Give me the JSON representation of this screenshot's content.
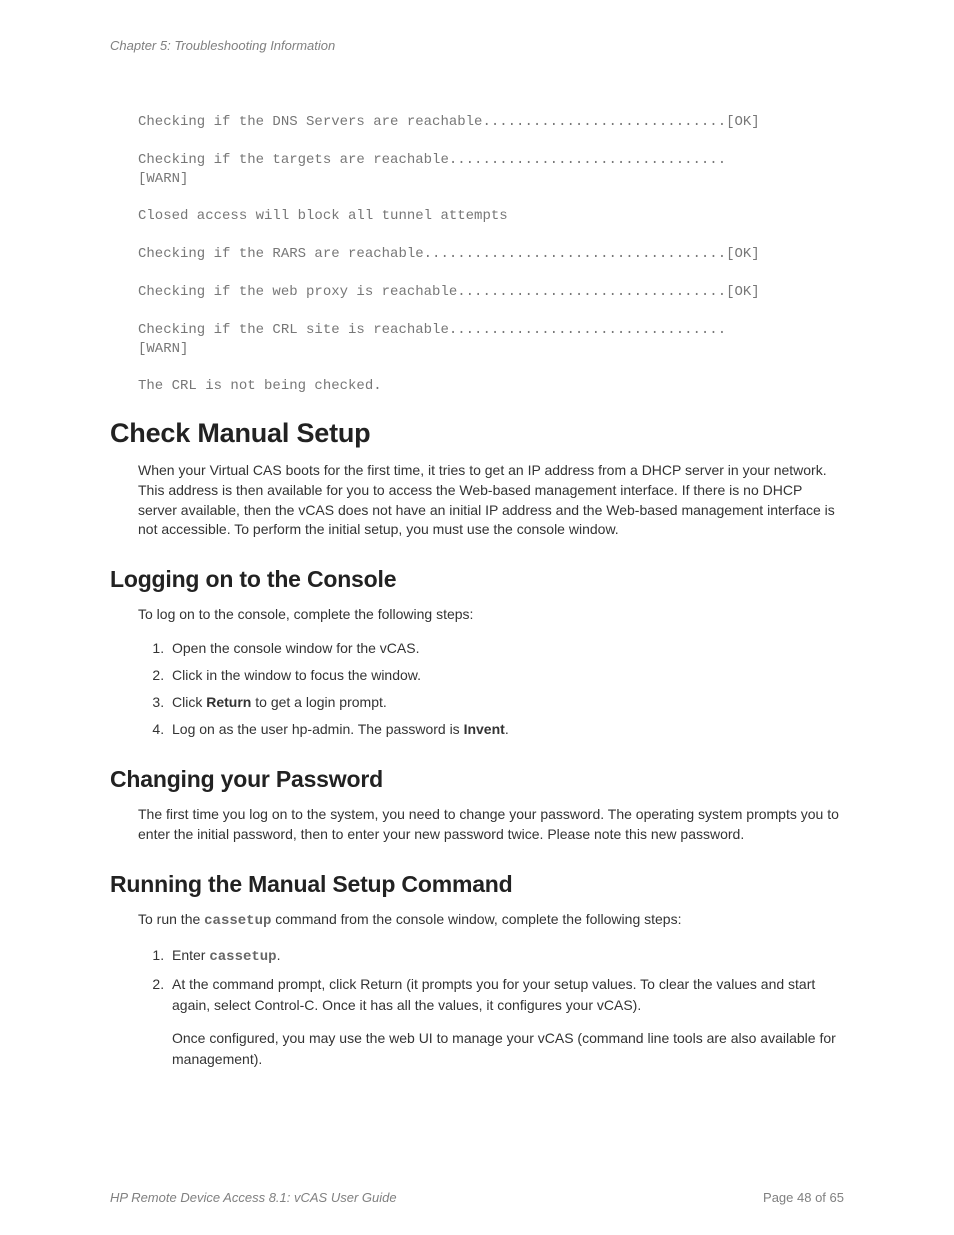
{
  "chapter": "Chapter 5: Troubleshooting Information",
  "code": {
    "l1": "Checking if the DNS Servers are reachable.............................[OK]",
    "l2": "Checking if the targets are reachable.................................",
    "l3": "[WARN]",
    "l4": "Closed access will block all tunnel attempts",
    "l5": "Checking if the RARS are reachable....................................[OK]",
    "l6": "Checking if the web proxy is reachable................................[OK]",
    "l7": "Checking if the CRL site is reachable.................................",
    "l8": "[WARN]",
    "l9": "The CRL is not being checked."
  },
  "h1_check_manual": "Check Manual Setup",
  "p_check_manual": "When your Virtual CAS boots for the first time, it tries to get an IP address from a DHCP server in your network. This address is then available for you to access the Web-based management interface.  If there is no DHCP server available, then the vCAS does not have an initial IP address and the Web-based management interface is not accessible. To perform the initial setup, you must use the console window.",
  "h2_logging": "Logging on to the Console",
  "p_logging": "To log on to the console, complete the following steps:",
  "steps_log": {
    "s1": "Open the console window for the vCAS.",
    "s2": "Click in the window to focus the window.",
    "s3a": "Click ",
    "s3b": "Return",
    "s3c": " to get a login prompt.",
    "s4a": "Log on as the user hp-admin. The password is ",
    "s4b": "Invent",
    "s4c": "."
  },
  "h2_changing": "Changing your Password",
  "p_changing": "The first time you log on to the system, you need to change your password. The operating system prompts you to enter the initial password, then to enter your new password twice. Please note this new password.",
  "h2_running": "Running the Manual Setup Command",
  "p_running_a": "To run the ",
  "p_running_b": "cassetup",
  "p_running_c": " command from the console window, complete the following steps:",
  "steps_run": {
    "s1a": "Enter ",
    "s1b": "cassetup",
    "s1c": ".",
    "s2": "At the command prompt, click Return (it prompts you for your setup values. To clear the values and start again, select Control-C. Once it has all the values, it configures your vCAS).",
    "s2_after": "Once configured, you may use the web UI to manage your vCAS (command line tools are also available for management)."
  },
  "footer": {
    "left": "HP Remote Device Access 8.1: vCAS User Guide",
    "right": "Page 48 of 65"
  }
}
